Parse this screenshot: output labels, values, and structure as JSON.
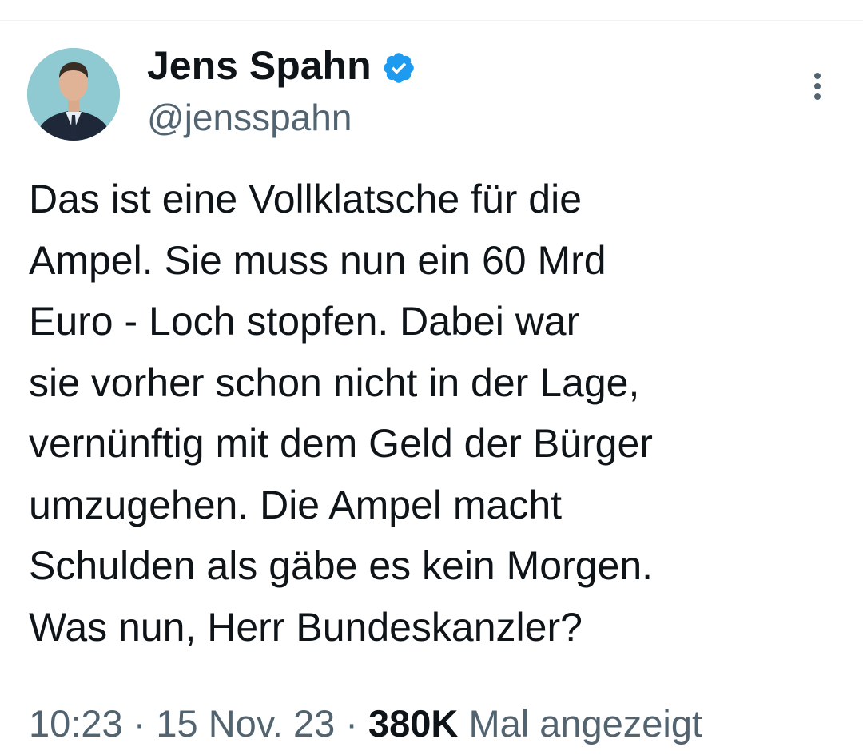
{
  "author": {
    "display_name": "Jens Spahn",
    "handle": "@jensspahn",
    "verified": true,
    "verified_icon": "verified-badge-icon",
    "avatar_icon": "profile-photo"
  },
  "tweet": {
    "lines": [
      "Das ist eine Vollklatsche für die",
      "Ampel. Sie muss nun ein 60 Mrd",
      "Euro - Loch stopfen. Dabei war",
      "sie vorher schon nicht in der Lage,",
      "vernünftig mit dem Geld der Bürger",
      "umzugehen. Die Ampel macht",
      "Schulden als gäbe es kein Morgen.",
      "Was nun, Herr Bundeskanzler?"
    ]
  },
  "meta": {
    "time": "10:23",
    "separator": "·",
    "date": "15 Nov. 23",
    "views_count": "380K",
    "views_label": "Mal angezeigt"
  },
  "colors": {
    "verified_blue": "#1d9bf0",
    "secondary_text": "#536471",
    "primary_text": "#0f1419"
  },
  "menu": {
    "more_icon": "more-vertical-icon"
  }
}
